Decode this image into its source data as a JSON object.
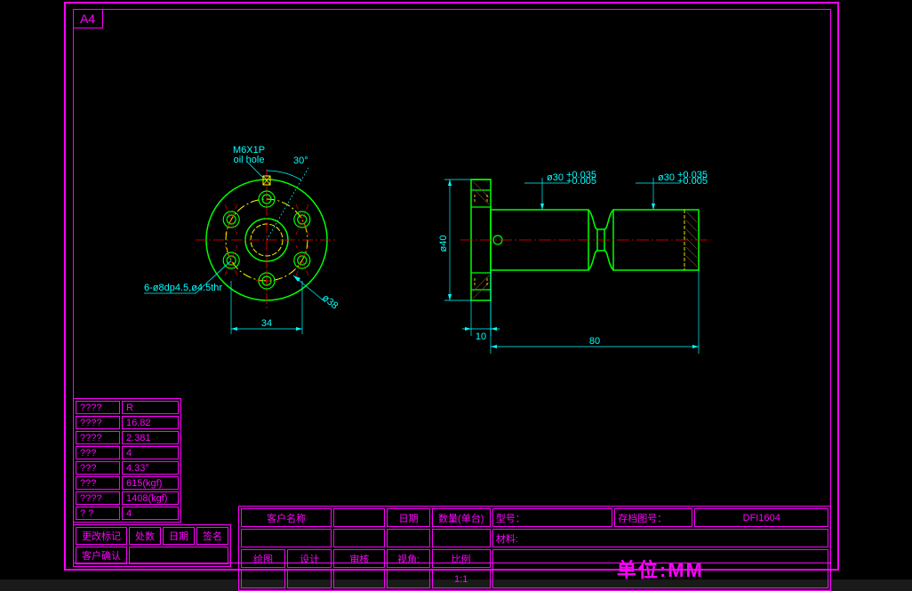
{
  "sheet": {
    "size": "A4"
  },
  "params": {
    "r0": {
      "label": "????",
      "value": "R"
    },
    "r1": {
      "label": "????",
      "value": "16.82"
    },
    "r2": {
      "label": "????",
      "value": "2.381"
    },
    "r3": {
      "label": "???",
      "value": "4"
    },
    "r4": {
      "label": "???",
      "value": "4.33°"
    },
    "r5": {
      "label": "???",
      "value": "615(kgf)"
    },
    "r6": {
      "label": "????",
      "value": "1408(kgf)"
    },
    "r7": {
      "label": "?    ?",
      "value": "4"
    }
  },
  "revision": {
    "h1": "更改标记",
    "h2": "处数",
    "h3": "日期",
    "h4": "签名",
    "confirm": "客户确认"
  },
  "title_block": {
    "customer_lbl": "客户名称",
    "date_lbl": "日期",
    "qty_lbl": "数量(单台)",
    "model_lbl": "型号：",
    "archive_lbl": "存档图号：",
    "archive_no": "DFI1604",
    "material_lbl": "材料:",
    "draw_lbl": "绘图",
    "design_lbl": "设计",
    "check_lbl": "审核",
    "view_lbl": "视角:",
    "scale_lbl": "比例",
    "scale_val": "1:1",
    "unit": "单位:MM"
  },
  "annotations": {
    "oil_hole_1": "M6X1P",
    "oil_hole_2": "oil hole",
    "angle_30": "30°",
    "holes_callout": "6-ø8dp4.5,ø4.5thr",
    "dim_34": "34",
    "dim_d38": "ø38",
    "dim_d40": "ø40",
    "dim_10": "10",
    "dim_80": "80",
    "dim_d301": "ø30",
    "dim_d302": "ø30",
    "tol1": "+0.035",
    "tol2": "+0.005"
  }
}
